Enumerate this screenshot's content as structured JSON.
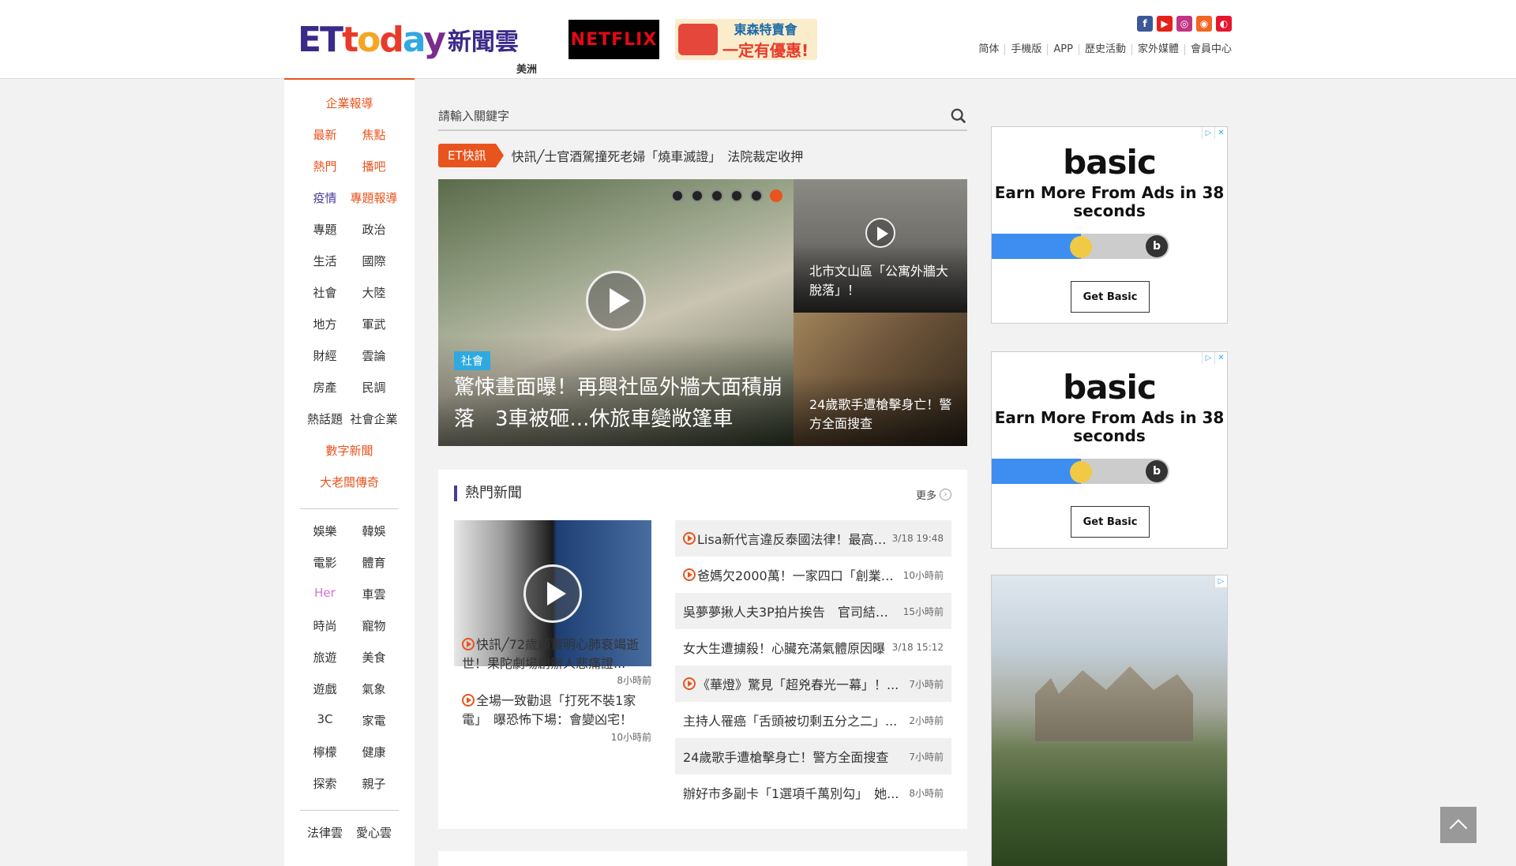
{
  "header": {
    "logo_text": "ETtoday",
    "logo_cn": "新聞雲",
    "region": "美洲",
    "netflix": "NETFLIX",
    "promo_line1": "東森特賣會",
    "promo_line2": "一定有優惠!",
    "social": [
      {
        "name": "facebook-icon",
        "glyph": "f",
        "color": "#3b5998"
      },
      {
        "name": "youtube-icon",
        "glyph": "▶",
        "color": "#e62117"
      },
      {
        "name": "instagram-icon",
        "glyph": "◎",
        "color": "#c13584"
      },
      {
        "name": "rss-icon",
        "glyph": "◉",
        "color": "#f26522"
      },
      {
        "name": "weibo-icon",
        "glyph": "◐",
        "color": "#e6162d"
      }
    ],
    "nav": [
      "简体",
      "手機版",
      "APP",
      "歷史活動",
      "家外媒體",
      "會員中心"
    ]
  },
  "sidebar": {
    "rows": [
      {
        "items": [
          "企業報導"
        ],
        "color": "orange",
        "single": true
      },
      {
        "items": [
          "最新",
          "焦點"
        ],
        "color": "orange"
      },
      {
        "items": [
          "熱門",
          "播吧"
        ],
        "color": "orange"
      },
      {
        "items": [
          "疫情",
          "專題報導"
        ],
        "colors": [
          "purple",
          "orange"
        ]
      },
      {
        "items": [
          "專題",
          "政治"
        ],
        "color": "dark"
      },
      {
        "items": [
          "生活",
          "國際"
        ],
        "color": "dark"
      },
      {
        "items": [
          "社會",
          "大陸"
        ],
        "color": "dark"
      },
      {
        "items": [
          "地方",
          "軍武"
        ],
        "color": "dark"
      },
      {
        "items": [
          "財經",
          "雲論"
        ],
        "color": "dark"
      },
      {
        "items": [
          "房產",
          "民調"
        ],
        "color": "dark"
      },
      {
        "items": [
          "熱話題",
          "社會企業"
        ],
        "color": "dark"
      },
      {
        "items": [
          "數字新聞"
        ],
        "color": "orange",
        "single": true
      },
      {
        "items": [
          "大老闆傳奇"
        ],
        "color": "orange",
        "single": true
      },
      {
        "items": [
          "娛樂",
          "韓娛"
        ],
        "color": "dark"
      },
      {
        "items": [
          "電影",
          "體育"
        ],
        "color": "dark"
      },
      {
        "items": [
          "Her",
          "車雲"
        ],
        "colors": [
          "pink",
          "dark"
        ]
      },
      {
        "items": [
          "時尚",
          "寵物"
        ],
        "color": "dark"
      },
      {
        "items": [
          "旅遊",
          "美食"
        ],
        "color": "dark"
      },
      {
        "items": [
          "遊戲",
          "氣象"
        ],
        "color": "dark"
      },
      {
        "items": [
          "3C",
          "家電"
        ],
        "color": "dark"
      },
      {
        "items": [
          "檸檬",
          "健康"
        ],
        "color": "dark"
      },
      {
        "items": [
          "探索",
          "親子"
        ],
        "color": "dark"
      },
      {
        "items": [
          "法律雲",
          "愛心雲"
        ],
        "color": "dark"
      }
    ]
  },
  "search": {
    "placeholder": "請輸入關鍵字"
  },
  "flash": {
    "badge": "ET快訊",
    "text": "快訊╱士官酒駕撞死老婦「燒車滅證」　法院裁定收押"
  },
  "hero": {
    "tag": "社會",
    "title": "驚悚畫面曝！再興社區外牆大面積崩落　3車被砸...休旅車變敞篷車",
    "dots": 6,
    "active_dot": 6
  },
  "side_cards": [
    {
      "title": "北市文山區「公寓外牆大脫落」！"
    },
    {
      "title": "24歲歌手遭槍擊身亡！警方全面搜查"
    }
  ],
  "hot": {
    "title": "熱門新聞",
    "more": "更多",
    "left": [
      {
        "title": "快訊╱72歲顧寶明心肺衰竭逝世！果陀劇場創辦人悲痛證...",
        "time": "8小時前"
      },
      {
        "title": "全場一致勸退「打死不裝1家電」　曝恐怖下場：會變凶宅！",
        "time": "10小時前"
      }
    ],
    "list": [
      {
        "title": "Lisa新代言違反泰國法律！最高「...",
        "time": "3/18 19:48",
        "video": true
      },
      {
        "title": "爸媽欠2000萬！一家四口「創業賣...",
        "time": "10小時前",
        "video": true
      },
      {
        "title": "吳夢夢揪人夫3P拍片挨告　官司結果...",
        "time": "15小時前",
        "video": false
      },
      {
        "title": "女大生遭擄殺！心臟充滿氣體原因曝",
        "time": "3/18 15:12",
        "video": false
      },
      {
        "title": "《華燈》驚見「超兇春光一幕」！...",
        "time": "7小時前",
        "video": true
      },
      {
        "title": "主持人罹癌「舌頭被切剩五分之二」...",
        "time": "2小時前",
        "video": false
      },
      {
        "title": "24歲歌手遭槍擊身亡！警方全面搜查",
        "time": "7小時前",
        "video": false
      },
      {
        "title": "辦好市多副卡「1選項千萬別勾」　她...",
        "time": "8小時前",
        "video": false
      }
    ]
  },
  "ads": [
    {
      "brand": "basic",
      "headline": "Earn More From Ads in 38 seconds",
      "cta": "Get Basic",
      "progress": 0.5
    },
    {
      "brand": "basic",
      "headline": "Earn More From Ads in 38 seconds",
      "cta": "Get Basic",
      "progress": 0.5
    }
  ],
  "ad_chips": [
    "▷",
    "✕"
  ],
  "ad_end_glyph": "b",
  "scroll_top_icon": "arrow-up-icon"
}
